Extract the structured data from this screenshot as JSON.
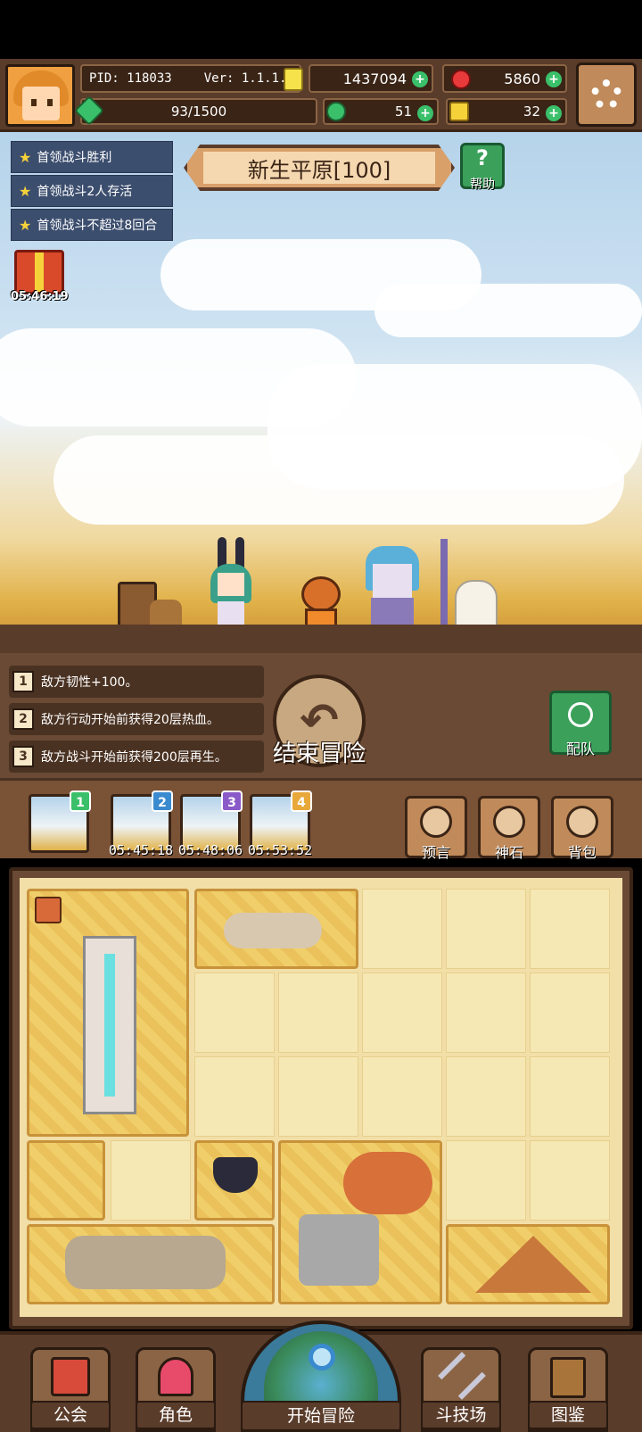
{
  "player": {
    "pid": "PID: 118033",
    "version": "Ver: 1.1.1.3",
    "gold": "1437094",
    "gems": "5860",
    "exp": "93/1500",
    "clovers": "51",
    "keys": "32"
  },
  "quests": [
    "首领战斗胜利",
    "首领战斗2人存活",
    "首领战斗不超过8回合"
  ],
  "gift_timer": "05:46:19",
  "stage": {
    "name": "新生平原[100]",
    "help_label": "帮助"
  },
  "modifiers": [
    {
      "num": "1",
      "text": "敌方韧性+100。"
    },
    {
      "num": "2",
      "text": "敌方行动开始前获得20层热血。"
    },
    {
      "num": "3",
      "text": "敌方战斗开始前获得200层再生。"
    }
  ],
  "actions": {
    "end_label": "结束冒险",
    "team_label": "配队"
  },
  "slots": [
    {
      "num": "1",
      "color": "#3ac06a",
      "time": ""
    },
    {
      "num": "2",
      "color": "#3a8ad0",
      "time": "05:45:18"
    },
    {
      "num": "3",
      "color": "#8a5ac8",
      "time": "05:48:06"
    },
    {
      "num": "4",
      "color": "#e8a83a",
      "time": "05:53:52"
    }
  ],
  "side_buttons": {
    "prophecy": "预言",
    "godstone": "神石",
    "backpack": "背包"
  },
  "nav": {
    "guild": "公会",
    "character": "角色",
    "start": "开始冒险",
    "arena": "斗技场",
    "codex": "图鉴"
  }
}
